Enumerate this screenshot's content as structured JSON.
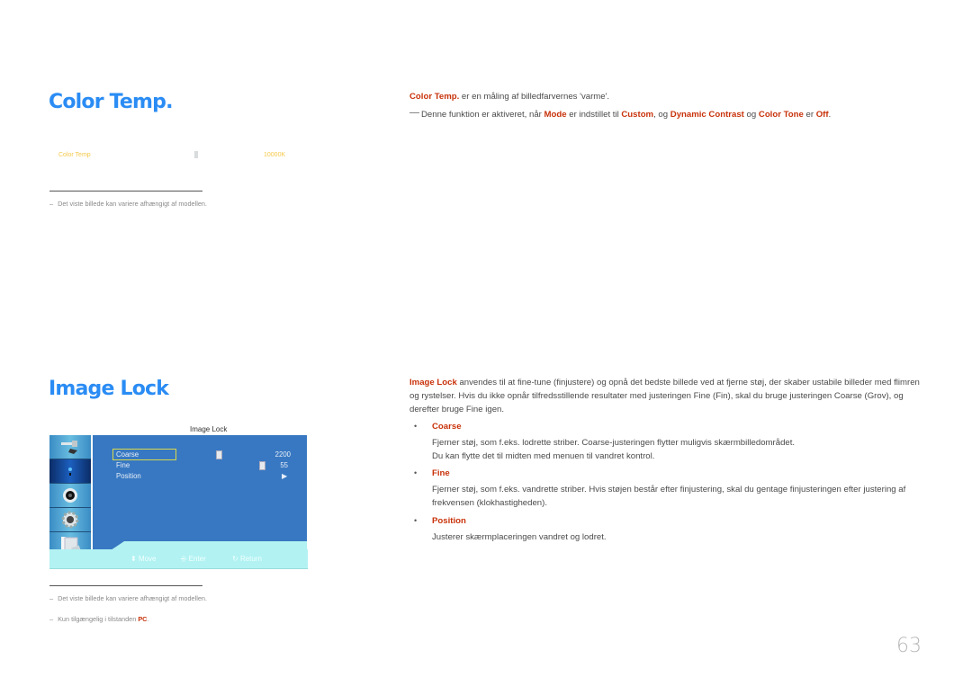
{
  "page_number": "63",
  "colors": {
    "heading": "#2a8cf4",
    "highlight": "#c8320a",
    "osd_label": "#f5c94a",
    "osd_background": "#3878c2",
    "osd_footer": "#b2f2f2"
  },
  "color_temp": {
    "title": "Color Temp.",
    "osd_row": {
      "label": "Color Temp",
      "value": "10000K"
    },
    "note": "Det viste billede kan variere afhængigt af modellen.",
    "description": {
      "term": "Color Temp.",
      "text": " er en måling af billedfarvernes 'varme'."
    },
    "condition": {
      "prefix": "Denne funktion er aktiveret, når ",
      "mode": "Mode",
      "part2": " er indstillet til ",
      "custom": "Custom",
      "part3": ", og ",
      "dynamic_contrast": "Dynamic Contrast",
      "part4": " og ",
      "color_tone": "Color Tone",
      "part5": " er ",
      "off": "Off",
      "suffix": "."
    }
  },
  "image_lock": {
    "title": "Image Lock",
    "osd": {
      "title": "Image Lock",
      "sidebar_icons": [
        "input-plug-icon",
        "picture-icon",
        "sound-icon",
        "setup-gear-icon",
        "multi-window-icon"
      ],
      "items": [
        {
          "label": "Coarse",
          "value": "2200",
          "slider_fraction": 0.42,
          "selected": true
        },
        {
          "label": "Fine",
          "value": "55",
          "slider_fraction": 0.9,
          "selected": false
        },
        {
          "label": "Position",
          "value": "▶",
          "selected": false
        }
      ],
      "footer": {
        "move": "Move",
        "enter": "Enter",
        "return": "Return"
      }
    },
    "notes": [
      {
        "text": "Det viste billede kan variere afhængigt af modellen."
      },
      {
        "prefix": "Kun tilgængelig i tilstanden ",
        "highlight": "PC",
        "suffix": "."
      }
    ],
    "description": {
      "term": "Image Lock",
      "text": " anvendes til at fine-tune (finjustere) og opnå det bedste billede ved at fjerne støj, der skaber ustabile billeder med flimren og rystelser. Hvis du ikke opnår tilfredsstillende resultater med justeringen Fine (Fin), skal du bruge justeringen Coarse (Grov), og derefter bruge Fine igen."
    },
    "bullets": [
      {
        "title": "Coarse",
        "lines": [
          "Fjerner støj, som f.eks. lodrette striber. Coarse-justeringen flytter muligvis skærmbilledområdet.",
          "Du kan flytte det til midten med menuen til vandret kontrol."
        ]
      },
      {
        "title": "Fine",
        "lines": [
          "Fjerner støj, som f.eks. vandrette striber. Hvis støjen består efter finjustering, skal du gentage finjusteringen efter justering af frekvensen (klokhastigheden)."
        ]
      },
      {
        "title": "Position",
        "lines": [
          "Justerer skærmplaceringen vandret og lodret."
        ]
      }
    ]
  }
}
